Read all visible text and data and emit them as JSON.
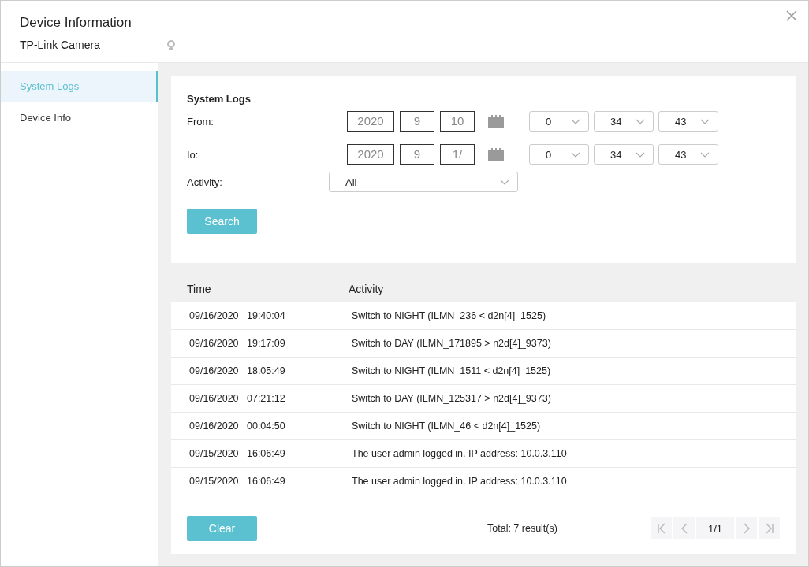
{
  "window": {
    "title": "Device Information",
    "subtitle": "TP-Link Camera"
  },
  "sidebar": {
    "items": [
      {
        "label": "System Logs",
        "selected": true
      },
      {
        "label": "Device Info",
        "selected": false
      }
    ]
  },
  "filter": {
    "title": "System Logs",
    "ranges": [
      {
        "label": "From:",
        "year": "2020",
        "month": "9",
        "day": "10",
        "hour": "0",
        "minute": "34",
        "second": "43"
      },
      {
        "label": "Io:",
        "year": "2020",
        "month": "9",
        "day": "1/",
        "hour": "0",
        "minute": "34",
        "second": "43"
      }
    ],
    "activity": {
      "label": "Activity:",
      "value": "All"
    },
    "search_button": "Search"
  },
  "table": {
    "columns": [
      "Time",
      "Activity"
    ],
    "rows": [
      {
        "date": "09/16/2020",
        "time": "19:40:04",
        "activity": "Switch to NIGHT (ILMN_236 < d2n[4]_1525)"
      },
      {
        "date": "09/16/2020",
        "time": "19:17:09",
        "activity": "Switch to DAY (ILMN_171895 > n2d[4]_9373)"
      },
      {
        "date": "09/16/2020",
        "time": "18:05:49",
        "activity": "Switch to NIGHT (ILMN_1511 < d2n[4]_1525)"
      },
      {
        "date": "09/16/2020",
        "time": "07:21:12",
        "activity": "Switch to DAY (ILMN_125317 > n2d[4]_9373)"
      },
      {
        "date": "09/16/2020",
        "time": "00:04:50",
        "activity": "Switch to NIGHT (ILMN_46 < d2n[4]_1525)"
      },
      {
        "date": "09/15/2020",
        "time": "16:06:49",
        "activity": "The user admin logged in. IP address: 10.0.3.110"
      },
      {
        "date": "09/15/2020",
        "time": "16:06:49",
        "activity": "The user admin logged in. IP address: 10.0.3.110"
      }
    ]
  },
  "footer": {
    "clear_button": "Clear",
    "total": "Total: 7 result(s)",
    "page": "1/1"
  }
}
